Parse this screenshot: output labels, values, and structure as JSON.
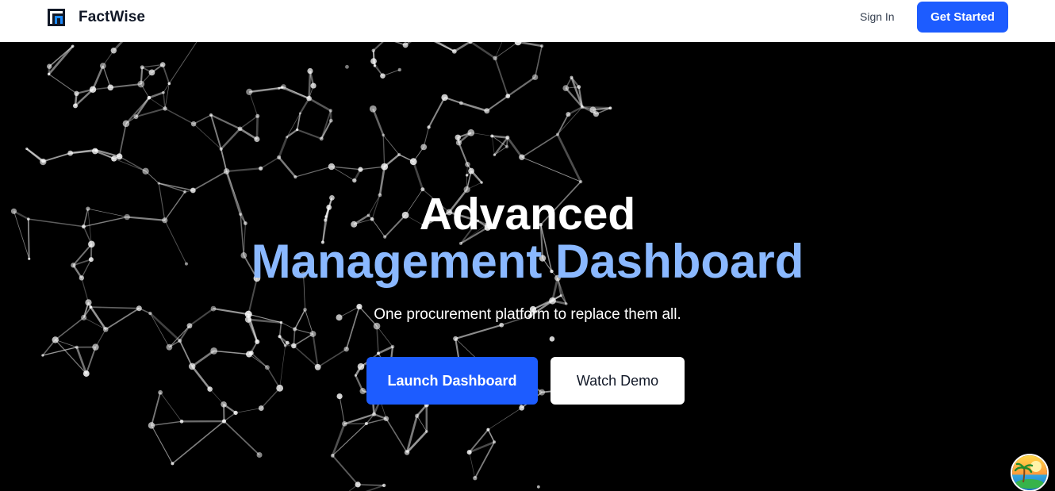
{
  "header": {
    "brand_name": "FactWise",
    "sign_in_label": "Sign In",
    "get_started_label": "Get Started",
    "logo_icon": "factwise-logo-icon",
    "accent_color": "#1d5cff"
  },
  "hero": {
    "headline_line1": "Advanced",
    "headline_line2": "Management Dashboard",
    "headline_line2_color": "#8ab8ff",
    "subtitle": "One procurement platform to replace them all.",
    "primary_button_label": "Launch Dashboard",
    "secondary_button_label": "Watch Demo",
    "background": "network-mesh"
  },
  "floating_widget": {
    "icon": "tropical-island-avatar-icon"
  }
}
